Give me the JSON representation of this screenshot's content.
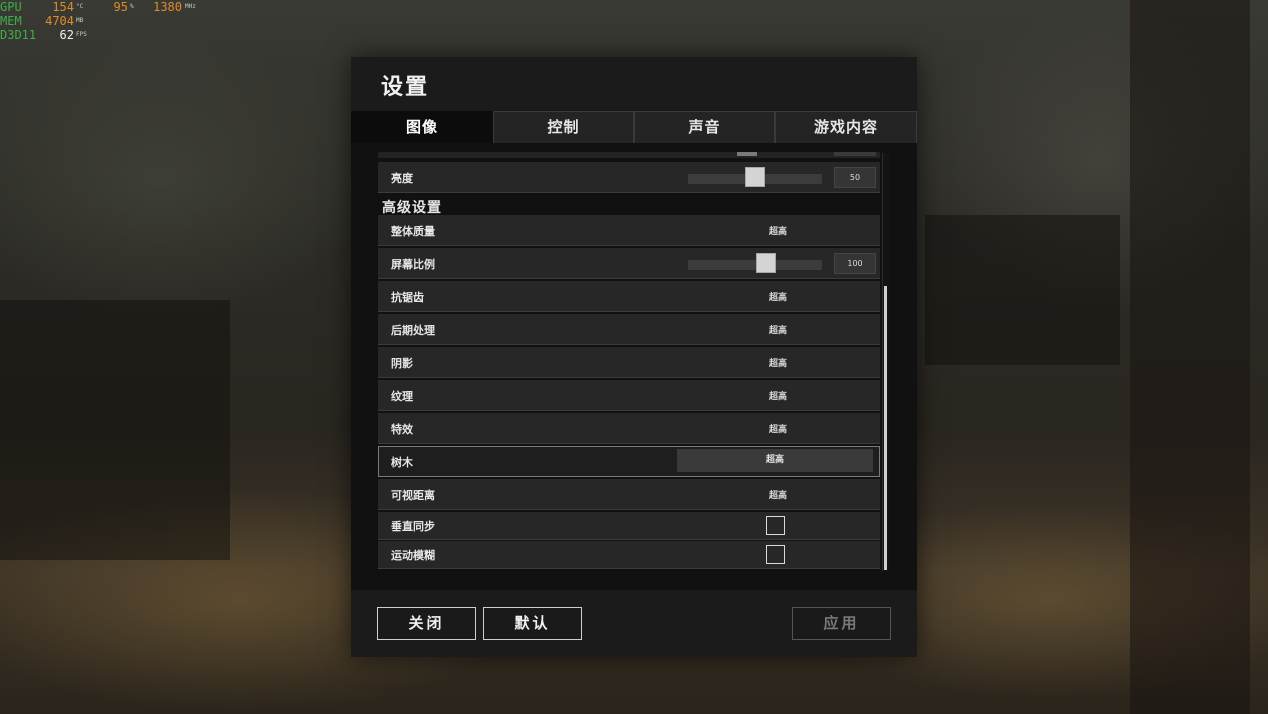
{
  "hud": {
    "gpu": {
      "label": "GPU",
      "value": "154",
      "unit": "°C",
      "pct": "95",
      "pct_unit": "%",
      "clock": "1380",
      "clock_unit": "MHz"
    },
    "mem": {
      "label": "MEM",
      "value": "4704",
      "unit": "MB"
    },
    "api": {
      "label": "D3D11",
      "value": "62",
      "unit": "FPS"
    }
  },
  "panel": {
    "title": "设置"
  },
  "tabs": [
    {
      "label": "图像",
      "active": true
    },
    {
      "label": "控制",
      "active": false
    },
    {
      "label": "声音",
      "active": false
    },
    {
      "label": "游戏内容",
      "active": false
    }
  ],
  "settings": {
    "brightness": {
      "label": "亮度",
      "value": "50",
      "level": 0.5
    },
    "advanced_title": "高级设置",
    "overall_quality": {
      "label": "整体质量",
      "value": "超高"
    },
    "screen_scale": {
      "label": "屏幕比例",
      "value": "100",
      "level": 0.6
    },
    "anti_aliasing": {
      "label": "抗锯齿",
      "value": "超高"
    },
    "post_processing": {
      "label": "后期处理",
      "value": "超高"
    },
    "shadows": {
      "label": "阴影",
      "value": "超高"
    },
    "textures": {
      "label": "纹理",
      "value": "超高"
    },
    "effects": {
      "label": "特效",
      "value": "超高"
    },
    "foliage": {
      "label": "树木",
      "value": "超高"
    },
    "view_distance": {
      "label": "可视距离",
      "value": "超高"
    },
    "vsync": {
      "label": "垂直同步",
      "checked": false
    },
    "motion_blur": {
      "label": "运动模糊",
      "checked": false
    }
  },
  "footer": {
    "close_label": "关闭",
    "default_label": "默认",
    "apply_label": "应用"
  },
  "colors": {
    "panel_bg": "#111111",
    "row_bg": "#272727",
    "hud_label": "#3fae4a",
    "hud_value": "#e08a2a"
  }
}
